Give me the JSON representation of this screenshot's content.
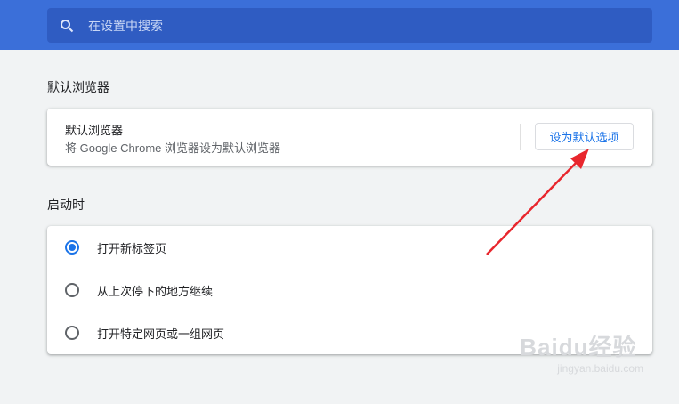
{
  "search": {
    "placeholder": "在设置中搜索",
    "icon": "search-icon"
  },
  "default_browser": {
    "section_title": "默认浏览器",
    "card_title": "默认浏览器",
    "card_desc": "将 Google Chrome 浏览器设为默认浏览器",
    "button_label": "设为默认选项"
  },
  "startup": {
    "section_title": "启动时",
    "options": [
      {
        "label": "打开新标签页",
        "checked": true
      },
      {
        "label": "从上次停下的地方继续",
        "checked": false
      },
      {
        "label": "打开特定网页或一组网页",
        "checked": false
      }
    ]
  },
  "watermark": {
    "brand": "Baidu经验",
    "sub": "jingyan.baidu.com"
  },
  "colors": {
    "topbar": "#3b6fd9",
    "accent": "#1a73e8",
    "annotation_arrow": "#e8262d"
  }
}
